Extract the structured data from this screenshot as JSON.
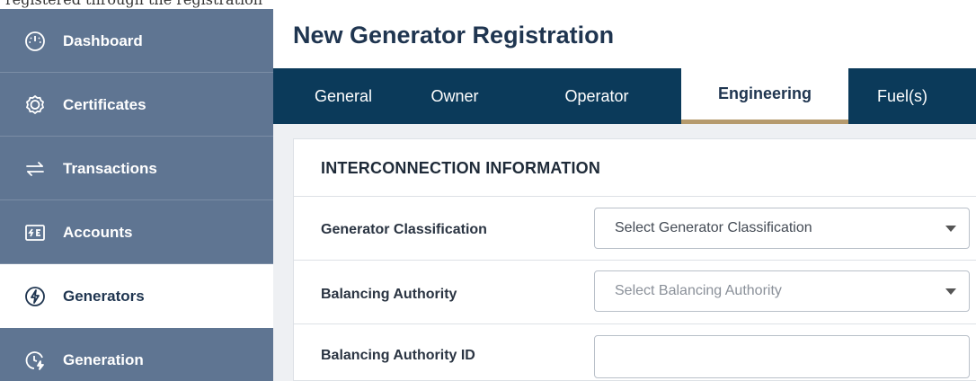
{
  "caption": "registered through the registration",
  "sidebar": {
    "items": [
      {
        "label": "Dashboard",
        "icon": "gauge-icon"
      },
      {
        "label": "Certificates",
        "icon": "certificate-badge-icon"
      },
      {
        "label": "Transactions",
        "icon": "transfer-arrows-icon"
      },
      {
        "label": "Accounts",
        "icon": "account-wallet-icon"
      },
      {
        "label": "Generators",
        "icon": "lightning-bolt-icon",
        "active": true
      },
      {
        "label": "Generation",
        "icon": "clock-bolt-icon"
      }
    ]
  },
  "main": {
    "title": "New Generator Registration",
    "tabs": [
      {
        "label": "General"
      },
      {
        "label": "Owner"
      },
      {
        "label": "Operator"
      },
      {
        "label": "Engineering",
        "active": true
      },
      {
        "label": "Fuel(s)"
      }
    ],
    "section_title": "INTERCONNECTION INFORMATION",
    "fields": {
      "generator_classification": {
        "label": "Generator Classification",
        "value": "Select Generator Classification"
      },
      "balancing_authority": {
        "label": "Balancing Authority",
        "placeholder": "Select Balancing Authority"
      },
      "balancing_authority_id": {
        "label": "Balancing Authority ID",
        "value": ""
      }
    }
  },
  "colors": {
    "sidebar_bg": "#5f7592",
    "tabbar_bg": "#0b3a5a",
    "active_tab_underline": "#b59a6d",
    "title_text": "#1f3550"
  }
}
